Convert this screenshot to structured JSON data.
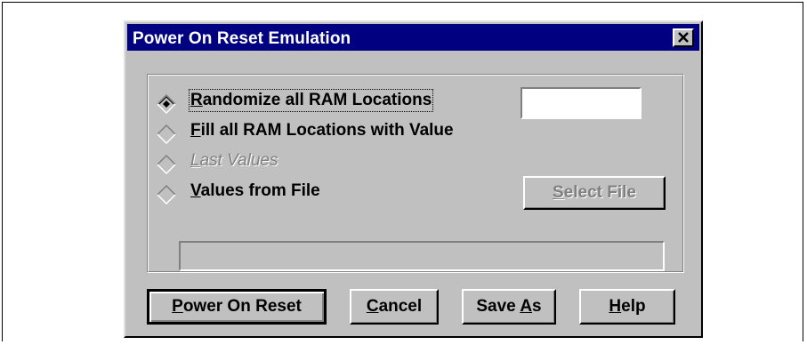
{
  "dialog": {
    "title": "Power On Reset Emulation",
    "close_icon": "close-x-icon"
  },
  "options": {
    "selected": "randomize",
    "randomize": {
      "pre": "",
      "key": "R",
      "post": "andomize all RAM Locations"
    },
    "fill": {
      "pre": "",
      "key": "F",
      "post": "ill all RAM Locations with Value"
    },
    "last": {
      "pre": "",
      "key": "L",
      "post": "ast Values"
    },
    "file": {
      "pre": "",
      "key": "V",
      "post": "alues from File"
    }
  },
  "fill_value": {
    "value": "",
    "placeholder": ""
  },
  "select_file_button": {
    "pre": "",
    "key": "S",
    "post": "elect File"
  },
  "file_path": {
    "value": ""
  },
  "buttons": {
    "power_on_reset": {
      "pre": "",
      "key": "P",
      "post": "ower On Reset"
    },
    "cancel": {
      "pre": "",
      "key": "C",
      "post": "ancel"
    },
    "save_as": {
      "pre": "Save ",
      "key": "A",
      "post": "s"
    },
    "help": {
      "pre": "",
      "key": "H",
      "post": "elp"
    }
  },
  "colors": {
    "titlebar": "#000080",
    "face": "#c0c0c0",
    "disabled_text": "#808080"
  }
}
